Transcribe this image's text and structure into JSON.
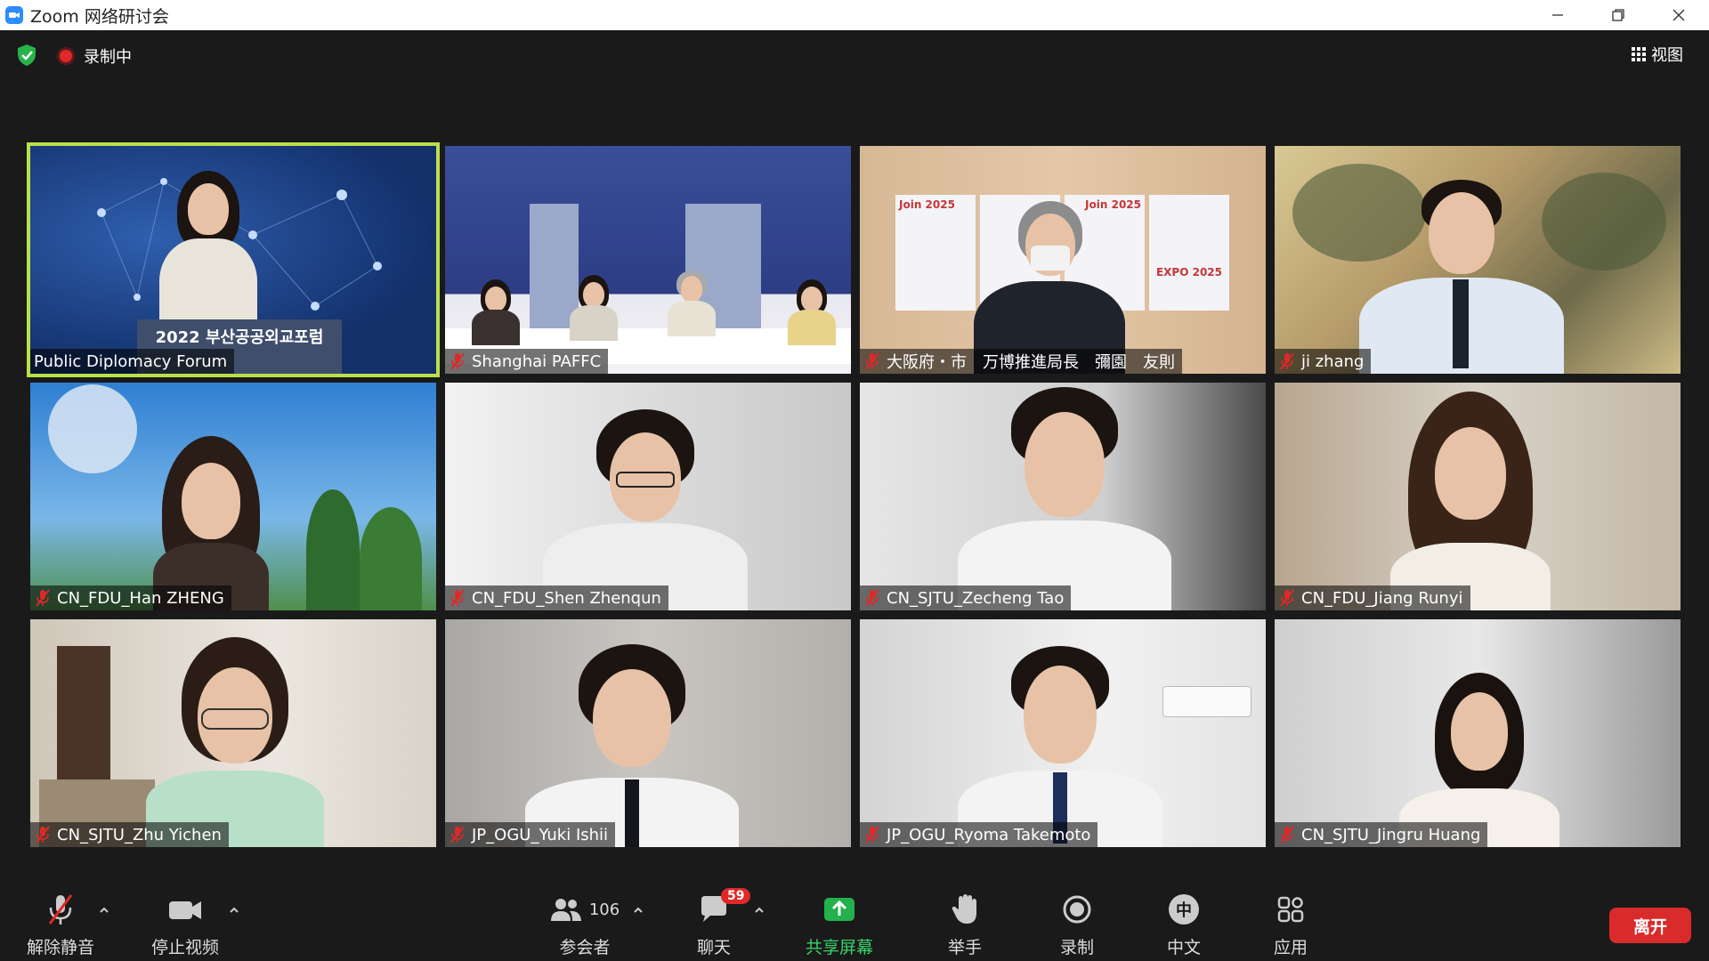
{
  "window": {
    "title": "Zoom 网络研讨会"
  },
  "topbar": {
    "recording_label": "录制中",
    "view_label": "视图"
  },
  "tiles": [
    {
      "name": "Public Diplomacy Forum",
      "muted": false,
      "active": true,
      "podium_text": "2022 부산공공외교포럼"
    },
    {
      "name": "Shanghai PAFFC",
      "muted": true,
      "active": false
    },
    {
      "name": "大阪府・市　万博推進局長　彌園　友則",
      "muted": true,
      "active": false,
      "poster_texts": [
        "Join 2025",
        "Join 2025",
        "EXPO 2025"
      ]
    },
    {
      "name": "ji zhang",
      "muted": true,
      "active": false
    },
    {
      "name": "CN_FDU_Han ZHENG",
      "muted": true,
      "active": false
    },
    {
      "name": "CN_FDU_Shen Zhenqun",
      "muted": true,
      "active": false
    },
    {
      "name": "CN_SJTU_Zecheng Tao",
      "muted": true,
      "active": false
    },
    {
      "name": "CN_FDU_Jiang Runyi",
      "muted": true,
      "active": false
    },
    {
      "name": "CN_SJTU_Zhu Yichen",
      "muted": true,
      "active": false
    },
    {
      "name": "JP_OGU_Yuki Ishii",
      "muted": true,
      "active": false
    },
    {
      "name": "JP_OGU_Ryoma Takemoto",
      "muted": true,
      "active": false
    },
    {
      "name": "CN_SJTU_Jingru Huang",
      "muted": true,
      "active": false
    }
  ],
  "toolbar": {
    "unmute_label": "解除静音",
    "stop_video_label": "停止视频",
    "participants_label": "参会者",
    "participants_count": "106",
    "chat_label": "聊天",
    "chat_badge": "59",
    "share_label": "共享屏幕",
    "raise_hand_label": "举手",
    "record_label": "录制",
    "language_label": "中文",
    "language_icon_text": "中",
    "apps_label": "应用",
    "leave_label": "离开"
  },
  "colors": {
    "active_speaker_border": "#b9e04a",
    "share_green": "#36d36a",
    "leave_red": "#d92b2b",
    "mute_red": "#e02828"
  }
}
